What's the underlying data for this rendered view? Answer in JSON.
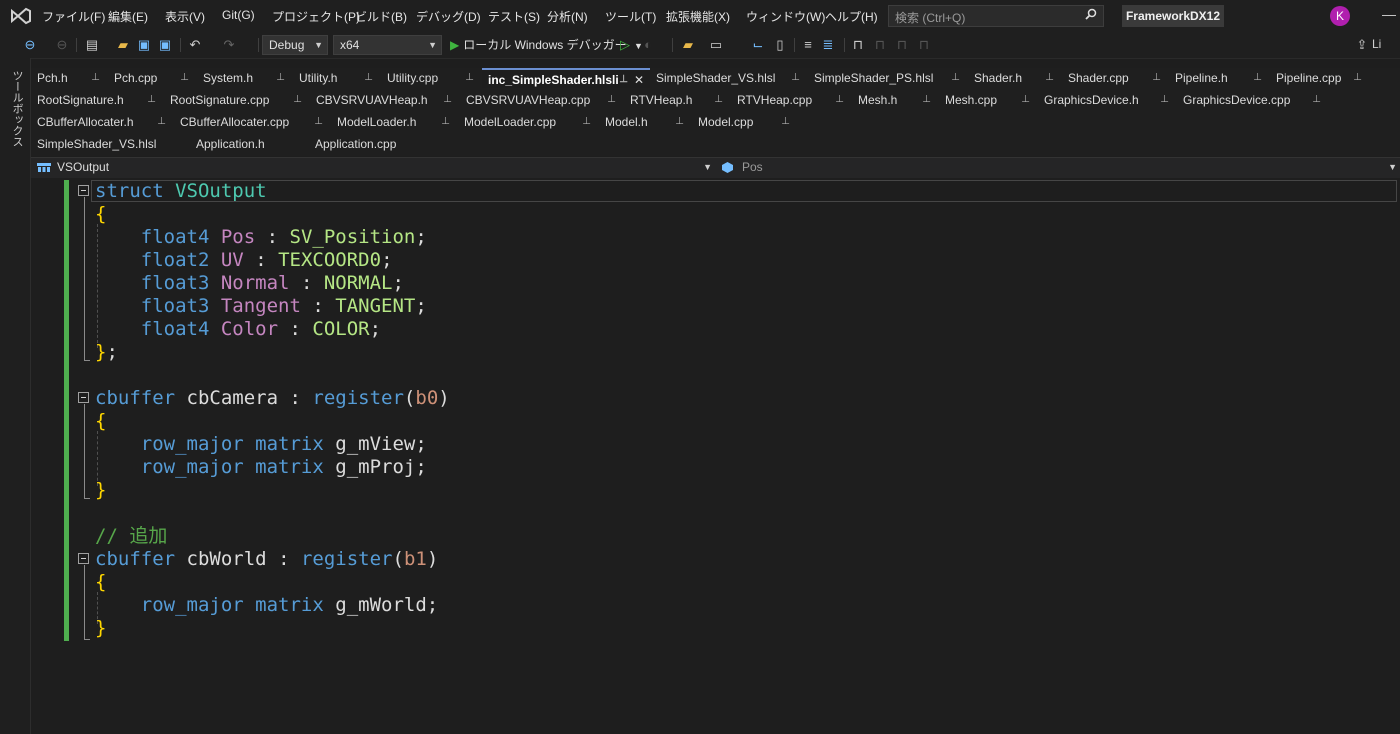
{
  "menubar": {
    "items": [
      "ファイル(F)",
      "編集(E)",
      "表示(V)",
      "Git(G)",
      "プロジェクト(P)",
      "ビルド(B)",
      "デバッグ(D)",
      "テスト(S)",
      "分析(N)",
      "ツール(T)",
      "拡張機能(X)",
      "ウィンドウ(W)",
      "ヘルプ(H)"
    ],
    "search_placeholder": "検索 (Ctrl+Q)",
    "project_name": "FrameworkDX12",
    "avatar_letter": "K",
    "window_min": "—"
  },
  "toolbar": {
    "config": "Debug",
    "platform": "x64",
    "run_label": "ローカル Windows デバッガー",
    "share_label": "Li"
  },
  "toolbox": {
    "label": "ツールボックス"
  },
  "tabs": {
    "row1": [
      {
        "label": "Pch.h"
      },
      {
        "label": "Pch.cpp"
      },
      {
        "label": "System.h"
      },
      {
        "label": "Utility.h"
      },
      {
        "label": "Utility.cpp"
      },
      {
        "label": "inc_SimpleShader.hlsli"
      },
      {
        "label": "SimpleShader_VS.hlsl"
      },
      {
        "label": "SimpleShader_PS.hlsl"
      },
      {
        "label": "Shader.h"
      },
      {
        "label": "Shader.cpp"
      },
      {
        "label": "Pipeline.h"
      },
      {
        "label": "Pipeline.cpp"
      }
    ],
    "row2": [
      {
        "label": "RootSignature.h"
      },
      {
        "label": "RootSignature.cpp"
      },
      {
        "label": "CBVSRVUAVHeap.h"
      },
      {
        "label": "CBVSRVUAVHeap.cpp"
      },
      {
        "label": "RTVHeap.h"
      },
      {
        "label": "RTVHeap.cpp"
      },
      {
        "label": "Mesh.h"
      },
      {
        "label": "Mesh.cpp"
      },
      {
        "label": "GraphicsDevice.h"
      },
      {
        "label": "GraphicsDevice.cpp"
      }
    ],
    "row3": [
      {
        "label": "CBufferAllocater.h"
      },
      {
        "label": "CBufferAllocater.cpp"
      },
      {
        "label": "ModelLoader.h"
      },
      {
        "label": "ModelLoader.cpp"
      },
      {
        "label": "Model.h"
      },
      {
        "label": "Model.cpp"
      }
    ],
    "row4": [
      {
        "label": "SimpleShader_VS.hlsl"
      },
      {
        "label": "Application.h"
      },
      {
        "label": "Application.cpp"
      }
    ],
    "pin_glyph": "⊥",
    "close_glyph": "✕"
  },
  "navbar": {
    "scope": "VSOutput",
    "member": "Pos"
  },
  "code": {
    "l1_kw": "struct",
    "l1_name": "VSOutput",
    "open1": "{",
    "fields": [
      {
        "type": "float4",
        "name": "Pos",
        "sem": "SV_Position"
      },
      {
        "type": "float2",
        "name": "UV",
        "sem": "TEXCOORD0"
      },
      {
        "type": "float3",
        "name": "Normal",
        "sem": "NORMAL"
      },
      {
        "type": "float3",
        "name": "Tangent",
        "sem": "TANGENT"
      },
      {
        "type": "float4",
        "name": "Color",
        "sem": "COLOR"
      }
    ],
    "close1": "}",
    "close1_semi": ";",
    "cb1_kw": "cbuffer",
    "cb1_name": "cbCamera",
    "cb1_reg_kw": "register",
    "cb1_reg": "b0",
    "cb1_lines": [
      {
        "mod": "row_major",
        "type": "matrix",
        "name": "g_mView"
      },
      {
        "mod": "row_major",
        "type": "matrix",
        "name": "g_mProj"
      }
    ],
    "comment": "// 追加",
    "cb2_kw": "cbuffer",
    "cb2_name": "cbWorld",
    "cb2_reg_kw": "register",
    "cb2_reg": "b1",
    "cb2_lines": [
      {
        "mod": "row_major",
        "type": "matrix",
        "name": "g_mWorld"
      }
    ]
  }
}
